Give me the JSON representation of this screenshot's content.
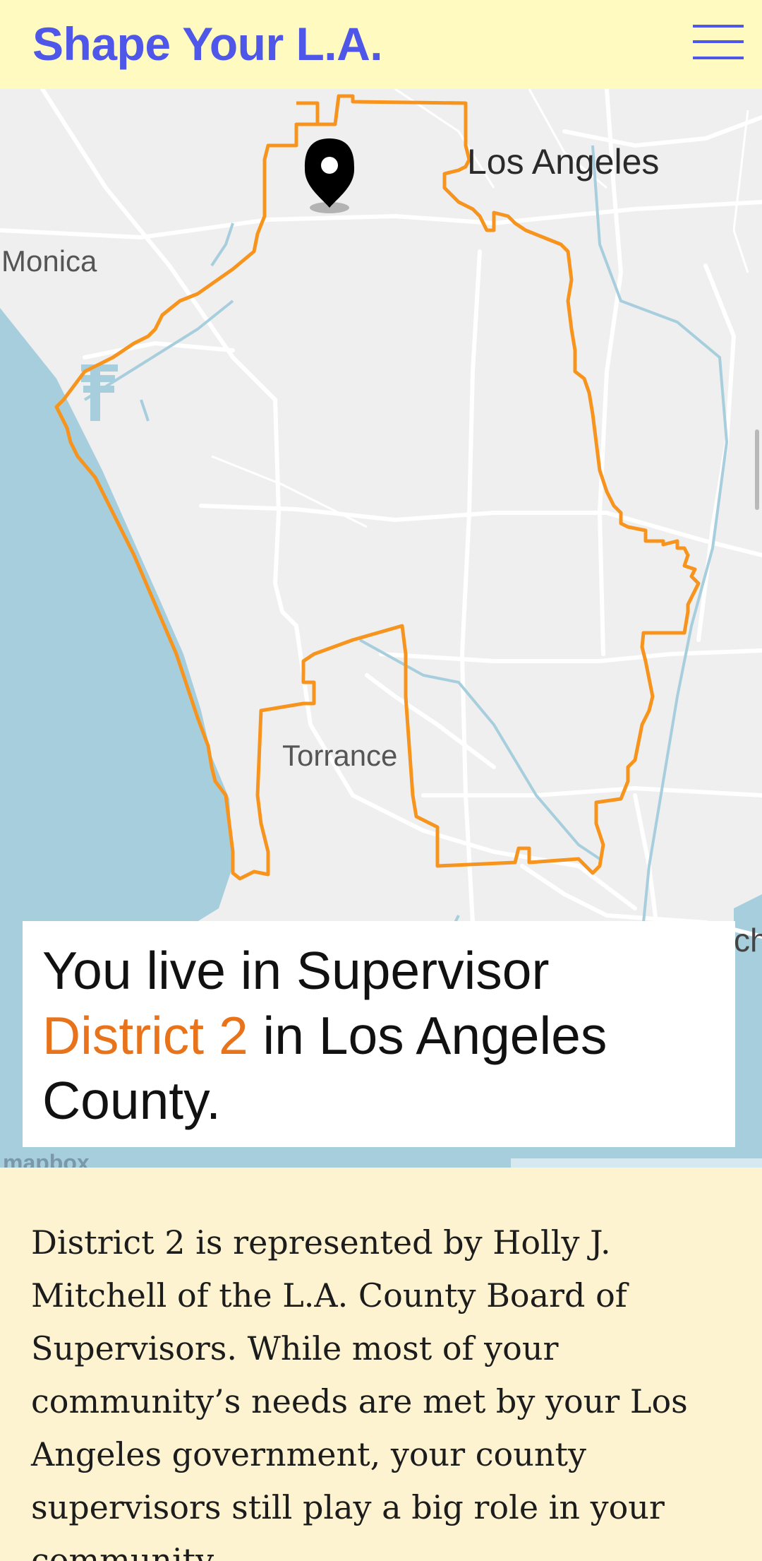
{
  "header": {
    "brand": "Shape Your L.A.",
    "menu_icon": "hamburger-menu-icon",
    "brand_color": "#4f57e8",
    "background": "#fffabf"
  },
  "map": {
    "labels": {
      "los_angeles": "Los Angeles",
      "monica": "Monica",
      "torrance": "Torrance",
      "partial_right": "ch"
    },
    "logo": "mapbox",
    "marker_icon": "map-pin-icon",
    "district_outline_color": "#f7941d",
    "water_color": "#a7cedd"
  },
  "result_card": {
    "prefix": "You live in Supervisor ",
    "district": "District 2",
    "suffix": " in Los Angeles County.",
    "highlight_color": "#e8731a"
  },
  "body": {
    "paragraph": "District 2 is represented by Holly J. Mitchell of the L.A. County Board of Supervisors. While most of your community’s needs are met by your Los Angeles government, your county supervisors still play a big role in your community."
  }
}
